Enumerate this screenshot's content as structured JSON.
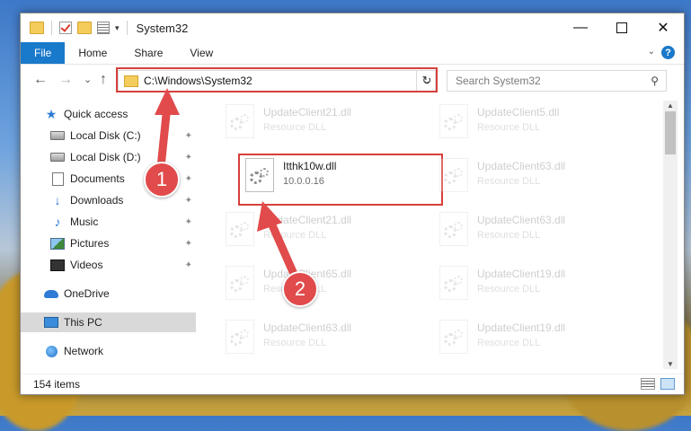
{
  "window": {
    "title": "System32",
    "minimize_label": "—",
    "close_label": "✕"
  },
  "ribbon": {
    "tabs": [
      "File",
      "Home",
      "Share",
      "View"
    ],
    "help_label": "?"
  },
  "nav": {
    "back": "←",
    "forward": "→",
    "recent": "⌄",
    "up": "↑",
    "address": "C:\\Windows\\System32",
    "address_dropdown": "⌄",
    "refresh": "↻",
    "search_placeholder": "Search System32",
    "search_icon": "⚲"
  },
  "sidebar": {
    "items": [
      {
        "label": "Quick access",
        "icon": "star-icon",
        "pinned": false
      },
      {
        "label": "Local Disk (C:)",
        "icon": "disk-icon",
        "pinned": true
      },
      {
        "label": "Local Disk (D:)",
        "icon": "disk-icon",
        "pinned": true
      },
      {
        "label": "Documents",
        "icon": "documents-icon",
        "pinned": true
      },
      {
        "label": "Downloads",
        "icon": "downloads-icon",
        "pinned": true
      },
      {
        "label": "Music",
        "icon": "music-icon",
        "pinned": true
      },
      {
        "label": "Pictures",
        "icon": "pictures-icon",
        "pinned": true
      },
      {
        "label": "Videos",
        "icon": "videos-icon",
        "pinned": true
      },
      {
        "label": "OneDrive",
        "icon": "cloud-icon",
        "pinned": false
      },
      {
        "label": "This PC",
        "icon": "pc-icon",
        "pinned": false,
        "selected": true
      },
      {
        "label": "Network",
        "icon": "network-icon",
        "pinned": false
      }
    ],
    "pin_glyph": "📌"
  },
  "files": [
    {
      "name": "UpdateClient21.dll",
      "type": "Resource DLL",
      "faded": true
    },
    {
      "name": "UpdateClient5.dll",
      "type": "Resource DLL",
      "faded": true
    },
    {
      "name": "Itthk10w.dll",
      "type": "10.0.0.16",
      "faded": false,
      "highlighted": true
    },
    {
      "name": "UpdateClient63.dll",
      "type": "Resource DLL",
      "faded": true
    },
    {
      "name": "UpdateClient21.dll",
      "type": "Resource DLL",
      "faded": true
    },
    {
      "name": "UpdateClient63.dll",
      "type": "Resource DLL",
      "faded": true
    },
    {
      "name": "UpdateClient65.dll",
      "type": "Resource DLL",
      "faded": true
    },
    {
      "name": "UpdateClient19.dll",
      "type": "Resource DLL",
      "faded": true
    },
    {
      "name": "UpdateClient63.dll",
      "type": "Resource DLL",
      "faded": true
    },
    {
      "name": "UpdateClient19.dll",
      "type": "Resource DLL",
      "faded": true
    }
  ],
  "status": {
    "item_count": "154 items"
  },
  "annotations": {
    "step1": "1",
    "step2": "2",
    "color": "#e14b4b"
  },
  "colors": {
    "accent": "#1979ca",
    "highlight_border": "#d6403b"
  }
}
